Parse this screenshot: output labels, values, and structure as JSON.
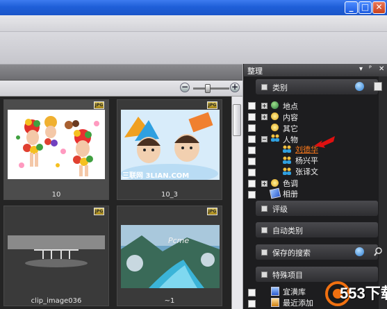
{
  "window": {
    "min_label": "_",
    "max_label": "□",
    "close_label": "✕"
  },
  "zoom": {
    "minus": "−",
    "plus": "+"
  },
  "photos": [
    {
      "label": "10",
      "badge": "JPG"
    },
    {
      "label": "10_3",
      "badge": "JPG",
      "watermark": "三联网 3LIAN.COM"
    },
    {
      "label": "clip_image036",
      "badge": "JPG"
    },
    {
      "label": "~1",
      "badge": "JPG",
      "watermark": "Pcme"
    }
  ],
  "panel": {
    "title": "整理",
    "header_icons": [
      "▾",
      "ᴾ",
      "✕"
    ],
    "sections": {
      "categories": "类别",
      "rating": "评级",
      "auto_categories": "自动类别",
      "saved_searches": "保存的搜索",
      "special_items": "特殊项目"
    },
    "tree": {
      "places": "地点",
      "content": "内容",
      "other": "其它",
      "people": "人物",
      "person1": "刘德华",
      "person2": "杨兴平",
      "person3": "张译文",
      "color": "色调",
      "album": "相册"
    },
    "special": {
      "item1": "宜潢库",
      "item2": "最近添加"
    }
  },
  "watermark": "553下载",
  "colors": {
    "accent": "#1f5fd8",
    "selected_person": "#ff7a1a",
    "arrow": "#e01010"
  }
}
